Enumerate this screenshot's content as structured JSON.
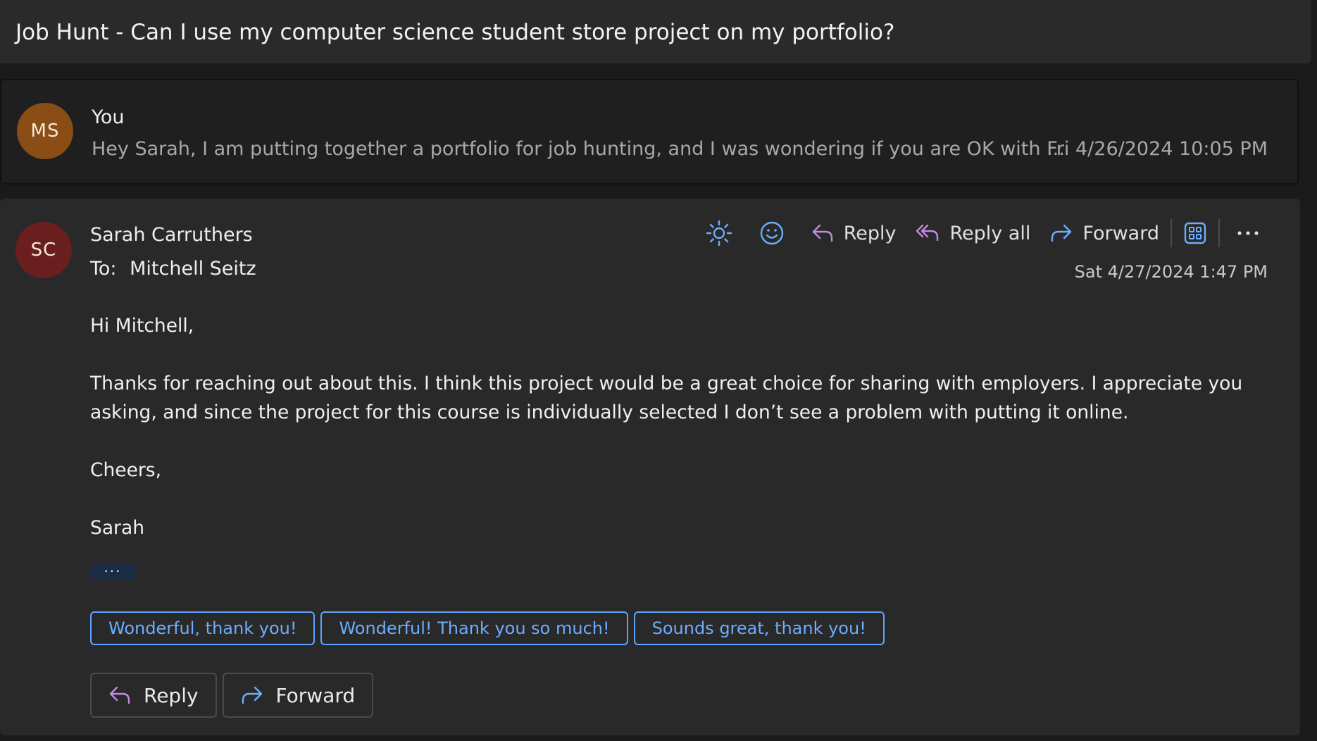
{
  "subject": "Job Hunt - Can I use my computer science student store project on my portfolio?",
  "collapsed_message": {
    "avatar_initials": "MS",
    "avatar_color": "#8a4d15",
    "sender": "You",
    "preview": "Hey Sarah, I am putting together a portfolio for job hunting, and I was wondering if you are OK with ...",
    "date": "Fri 4/26/2024 10:05 PM"
  },
  "expanded_message": {
    "avatar_initials": "SC",
    "avatar_color": "#6b1e1e",
    "sender": "Sarah Carruthers",
    "to_label": "To:",
    "to_name": "Mitchell Seitz",
    "date": "Sat 4/27/2024 1:47 PM",
    "toolbar": {
      "sun_icon": "sun-icon",
      "emoji_icon": "smiley-icon",
      "reply_label": "Reply",
      "reply_all_label": "Reply all",
      "forward_label": "Forward",
      "apps_icon": "apps-grid-icon",
      "more_icon": "more-horizontal-icon"
    },
    "body": {
      "greeting": "Hi Mitchell,",
      "paragraph": "Thanks for reaching out about this. I think this project would be a great choice for sharing with employers. I appreciate you asking, and since the project for this course is individually selected I don’t see a problem with putting it online.",
      "closing": "Cheers,",
      "signature": "Sarah"
    },
    "show_more": "···",
    "suggested_replies": [
      "Wonderful, thank you!",
      "Wonderful! Thank you so much!",
      "Sounds great, thank you!"
    ],
    "bottom_actions": {
      "reply_label": "Reply",
      "forward_label": "Forward"
    }
  },
  "colors": {
    "accent_blue": "#5ea4ff",
    "reply_purple": "#c08ae0",
    "forward_blue": "#6aaeff"
  }
}
